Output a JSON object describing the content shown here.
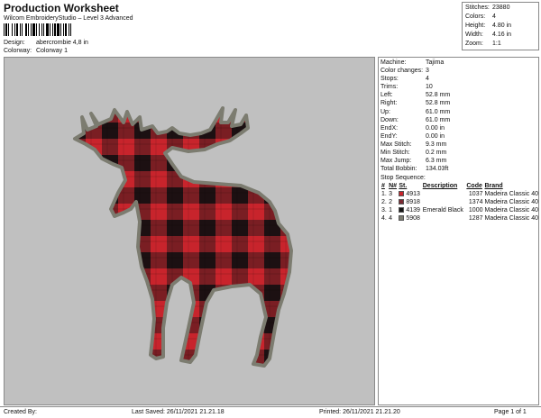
{
  "header": {
    "title": "Production Worksheet",
    "subtitle": "Wilcom EmbroideryStudio – Level 3 Advanced",
    "design_label": "Design:",
    "design_value": "abercrombie 4,8 in",
    "colorway_label": "Colorway:",
    "colorway_value": "Colorway 1"
  },
  "summary": [
    {
      "label": "Stitches:",
      "value": "23880"
    },
    {
      "label": "Colors:",
      "value": "4"
    },
    {
      "label": "Height:",
      "value": "4.80 in"
    },
    {
      "label": "Width:",
      "value": "4.16 in"
    },
    {
      "label": "Zoom:",
      "value": "1:1"
    }
  ],
  "machine_info": [
    {
      "label": "Machine:",
      "value": "Tajima"
    },
    {
      "label": "Color changes:",
      "value": "3"
    },
    {
      "label": "Stops:",
      "value": "4"
    },
    {
      "label": "Trims:",
      "value": "10"
    },
    {
      "label": "Left:",
      "value": "52.8 mm"
    },
    {
      "label": "Right:",
      "value": "52.8 mm"
    },
    {
      "label": "Up:",
      "value": "61.0 mm"
    },
    {
      "label": "Down:",
      "value": "61.0 mm"
    },
    {
      "label": "EndX:",
      "value": "0.00 in"
    },
    {
      "label": "EndY:",
      "value": "0.00 in"
    },
    {
      "label": "Max Stitch:",
      "value": "9.3 mm"
    },
    {
      "label": "Min Stitch:",
      "value": "0.2 mm"
    },
    {
      "label": "Max Jump:",
      "value": "6.3 mm"
    },
    {
      "label": "Total Bobbin:",
      "value": "134.03ft"
    }
  ],
  "stop_sequence": {
    "title": "Stop Sequence:",
    "headers": [
      "#",
      "N#",
      "St.",
      "Description",
      "Code",
      "Brand"
    ],
    "rows": [
      {
        "index": "1.",
        "n": "3",
        "color": "#c8242c",
        "st": "4913",
        "description": "",
        "code": "1037",
        "brand": "Madeira Classic 40"
      },
      {
        "index": "2.",
        "n": "2",
        "color": "#7a2a32",
        "st": "8918",
        "description": "",
        "code": "1374",
        "brand": "Madeira Classic 40"
      },
      {
        "index": "3.",
        "n": "1",
        "color": "#151515",
        "st": "4139",
        "description": "Emerald Black",
        "code": "1000",
        "brand": "Madeira Classic 40"
      },
      {
        "index": "4.",
        "n": "4",
        "color": "#7c7c70",
        "st": "5908",
        "description": "",
        "code": "1287",
        "brand": "Madeira Classic 40"
      }
    ]
  },
  "footer": {
    "created_by": "Created By:",
    "last_saved": "Last Saved: 26/11/2021 21.21.18",
    "printed": "Printed: 26/11/2021 21.21.20",
    "page": "Page 1 of 1"
  },
  "colors": {
    "canvas_bg": "#c0c0c0",
    "plaid_red": "#c8242c",
    "plaid_dark": "#2a1416",
    "outline": "#7c7c70"
  }
}
